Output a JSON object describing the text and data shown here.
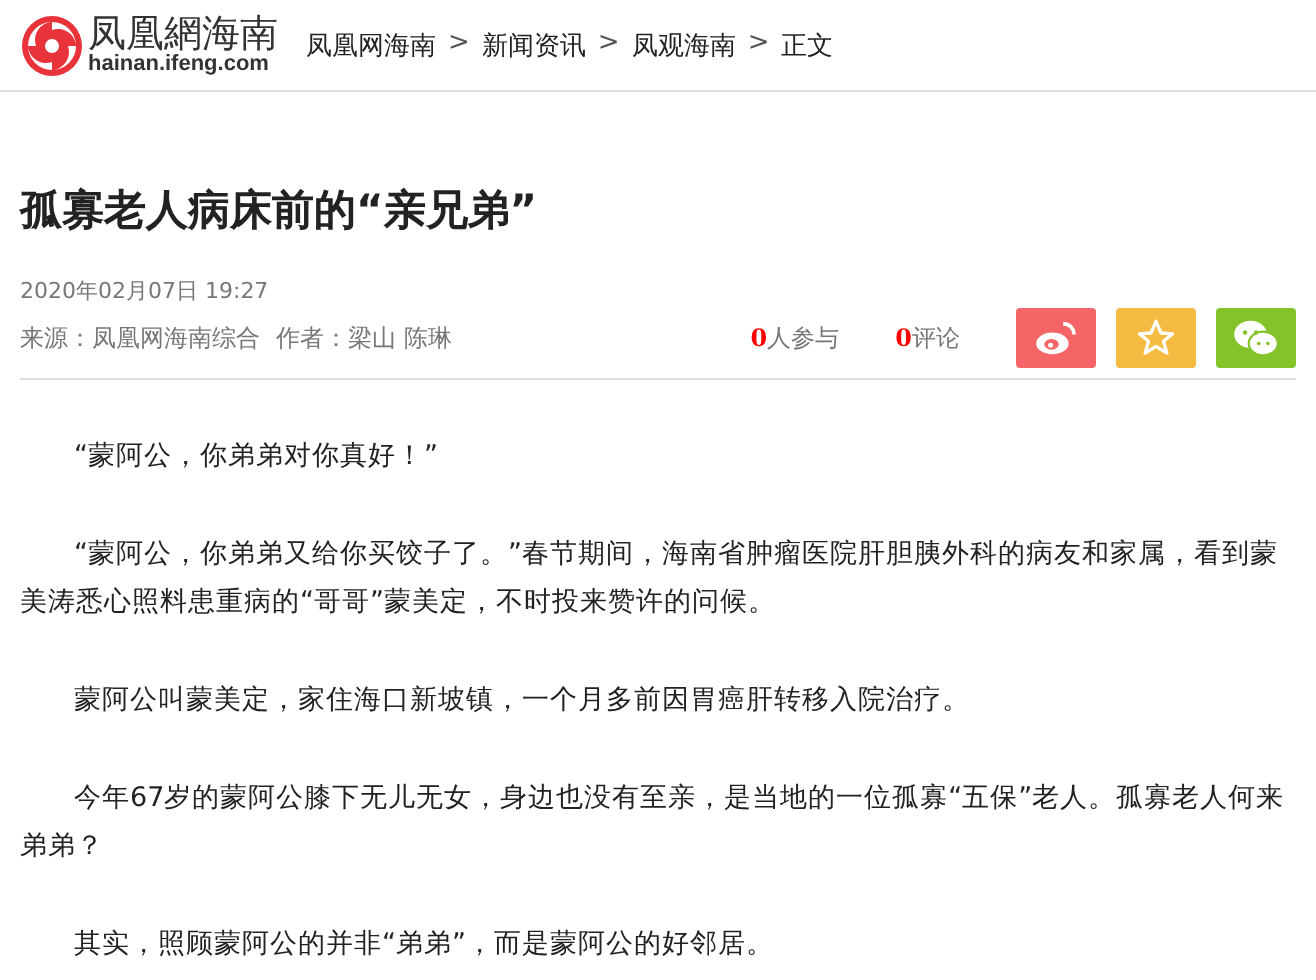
{
  "header": {
    "logo": {
      "name": "凤凰網海南",
      "domain": "hainan.ifeng.com"
    },
    "breadcrumb": [
      "凤凰网海南",
      "新闻资讯",
      "凤观海南",
      "正文"
    ],
    "separator": ">"
  },
  "article": {
    "title": "孤寡老人病床前的“亲兄弟”",
    "date": "2020年02月07日  19:27",
    "source": "来源：凤凰网海南综合",
    "author": "作者：梁山  陈琳",
    "stats": [
      {
        "count": "0",
        "label": "人参与"
      },
      {
        "count": "0",
        "label": "评论"
      }
    ],
    "share": [
      {
        "kind": "weibo",
        "color": "#f56467"
      },
      {
        "kind": "favorite",
        "color": "#f5ba42"
      },
      {
        "kind": "wechat",
        "color": "#84c32a"
      }
    ],
    "paragraphs": [
      "“蒙阿公，你弟弟对你真好！”",
      "“蒙阿公，你弟弟又给你买饺子了。”春节期间，海南省肿瘤医院肝胆胰外科的病友和家属，看到蒙美涛悉心照料患重病的“哥哥”蒙美定，不时投来赞许的问候。",
      "蒙阿公叫蒙美定，家住海口新坡镇，一个月多前因胃癌肝转移入院治疗。",
      "今年67岁的蒙阿公膝下无儿无女，身边也没有至亲，是当地的一位孤寡“五保”老人。孤寡老人何来弟弟？",
      "其实，照顾蒙阿公的并非“弟弟”，而是蒙阿公的好邻居。"
    ]
  }
}
